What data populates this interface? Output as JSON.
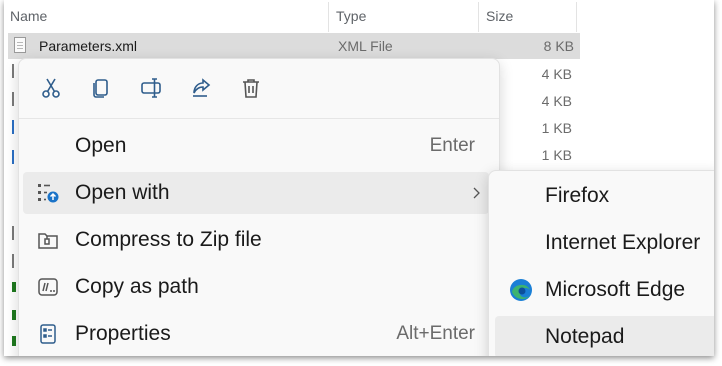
{
  "list": {
    "columns": {
      "name": "Name",
      "type": "Type",
      "size": "Size"
    },
    "selected_file": {
      "name": "Parameters.xml",
      "type": "XML File",
      "size": "8 KB"
    },
    "other_sizes": [
      "4 KB",
      "4 KB",
      "1 KB",
      "1 KB"
    ]
  },
  "context_menu": {
    "actions": [
      {
        "name": "cut",
        "icon": "scissors-icon"
      },
      {
        "name": "copy",
        "icon": "copy-icon"
      },
      {
        "name": "rename",
        "icon": "rename-icon"
      },
      {
        "name": "share",
        "icon": "share-icon"
      },
      {
        "name": "delete",
        "icon": "trash-icon"
      }
    ],
    "items": [
      {
        "label": "Open",
        "shortcut": "Enter",
        "icon": ""
      },
      {
        "label": "Open with",
        "shortcut": "",
        "icon": "open-with-icon",
        "has_submenu": true
      },
      {
        "label": "Compress to Zip file",
        "shortcut": "",
        "icon": "zip-folder-icon"
      },
      {
        "label": "Copy as path",
        "shortcut": "",
        "icon": "copy-path-icon"
      },
      {
        "label": "Properties",
        "shortcut": "Alt+Enter",
        "icon": "properties-icon"
      }
    ]
  },
  "open_with_submenu": {
    "items": [
      {
        "label": "Firefox",
        "icon": ""
      },
      {
        "label": "Internet Explorer",
        "icon": ""
      },
      {
        "label": "Microsoft Edge",
        "icon": "edge-icon"
      },
      {
        "label": "Notepad",
        "icon": ""
      }
    ]
  },
  "colors": {
    "accent": "#0a5fb4",
    "hover": "#ebebeb",
    "selected_row": "#dcdcdc",
    "edge_blue": "#1a7fd6",
    "edge_green": "#3cb371"
  }
}
